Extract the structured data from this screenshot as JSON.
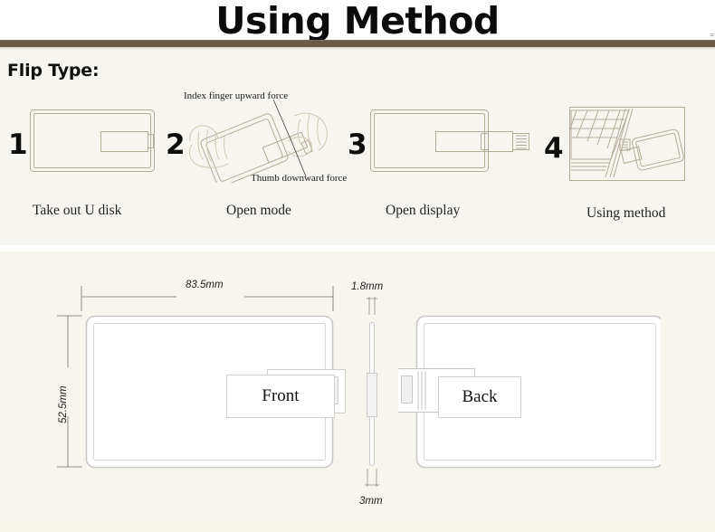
{
  "header": {
    "title": "Using Method",
    "edge_mark": "="
  },
  "section_one": {
    "heading": "Flip Type:",
    "steps": [
      {
        "number": "1",
        "caption": "Take out U disk",
        "icon": "card-usb-closed-icon"
      },
      {
        "number": "2",
        "caption": "Open mode",
        "icon": "hand-flipping-card-icon",
        "annotations": [
          "Index finger upward force",
          "Thumb downward force"
        ]
      },
      {
        "number": "3",
        "caption": "Open display",
        "icon": "card-usb-extended-icon"
      },
      {
        "number": "4",
        "caption": "Using method",
        "icon": "laptop-card-plugged-icon"
      }
    ]
  },
  "section_two": {
    "front": {
      "label": "Front",
      "width_label": "83.5mm",
      "height_label": "52.5mm"
    },
    "side": {
      "thickness_label": "1.8mm",
      "connector_label": "3mm"
    },
    "back": {
      "label": "Back"
    }
  },
  "colors": {
    "page_background": "#ffffff",
    "panel_background": "#f7f5ef",
    "rule_brown": "#6a5a46",
    "line_art": "#b3ad98",
    "text_dark": "#111111"
  }
}
